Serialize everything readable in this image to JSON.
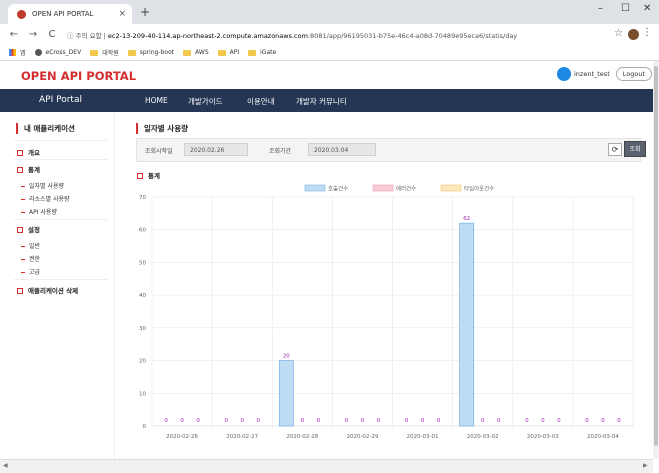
{
  "browser": {
    "tab_title": "OPEN API PORTAL",
    "tab_close": "×",
    "new_tab": "+",
    "window_controls": [
      "–",
      "☐",
      "✕"
    ],
    "nav_icons": [
      "←",
      "→",
      "C"
    ],
    "secure_label": "ⓘ 주의 요함",
    "url_host": "ec2-13-209-40-114.ap-northeast-2.compute.amazonaws.com",
    "url_path": ":8081/app/96195031-b75e-46c4-a08d-70489e95eca6/statis/day",
    "star": "☆",
    "menu": "⋮",
    "bookmarks": [
      "앱",
      "eCross_DEV",
      "대학원",
      "spring-boot",
      "AWS",
      "API",
      "iGate"
    ]
  },
  "header": {
    "brand": "OPEN API PORTAL",
    "username": "inzent_test",
    "logout": "Logout"
  },
  "topnav": {
    "portal": "API Portal",
    "items": [
      "HOME",
      "개발가이드",
      "이용안내",
      "개발자 커뮤니티"
    ]
  },
  "sidebar": {
    "title": "내 애플리케이션",
    "overview": "개요",
    "stats": "통계",
    "stats_items": [
      "일자별 사용량",
      "리소스별 사용량",
      "API 사용량"
    ],
    "settings": "설정",
    "settings_items": [
      "일반",
      "권한",
      "고급"
    ],
    "delete": "애플리케이션 삭제"
  },
  "main": {
    "title": "일자별 사용량",
    "filter": {
      "start_label": "조회시작일",
      "start_value": "2020.02.26",
      "period_label": "조회기간",
      "end_value": "2020.03.04",
      "refresh_icon": "⟳",
      "search": "조회"
    },
    "stats_heading": "통계"
  },
  "chart_data": {
    "type": "bar",
    "categories": [
      "2020-02-26",
      "2020-02-27",
      "2020-02-28",
      "2020-02-29",
      "2020-03-01",
      "2020-03-02",
      "2020-03-03",
      "2020-03-04"
    ],
    "series": [
      {
        "name": "호출건수",
        "values": [
          0,
          0,
          20,
          0,
          0,
          62,
          0,
          0
        ],
        "color": "#bfdcf5",
        "border": "#7fb6e6"
      },
      {
        "name": "에러건수",
        "values": [
          0,
          0,
          0,
          0,
          0,
          0,
          0,
          0
        ],
        "color": "#f8cdd8",
        "border": "#ef9ab0"
      },
      {
        "name": "타임아웃건수",
        "values": [
          0,
          0,
          0,
          0,
          0,
          0,
          0,
          0
        ],
        "color": "#fde7bf",
        "border": "#f6c970"
      }
    ],
    "ylim": [
      0,
      70
    ],
    "yticks": [
      0,
      10,
      20,
      30,
      40,
      50,
      60,
      70
    ],
    "label_color": "#9c27b0",
    "grid": true,
    "legend": "top-center"
  }
}
